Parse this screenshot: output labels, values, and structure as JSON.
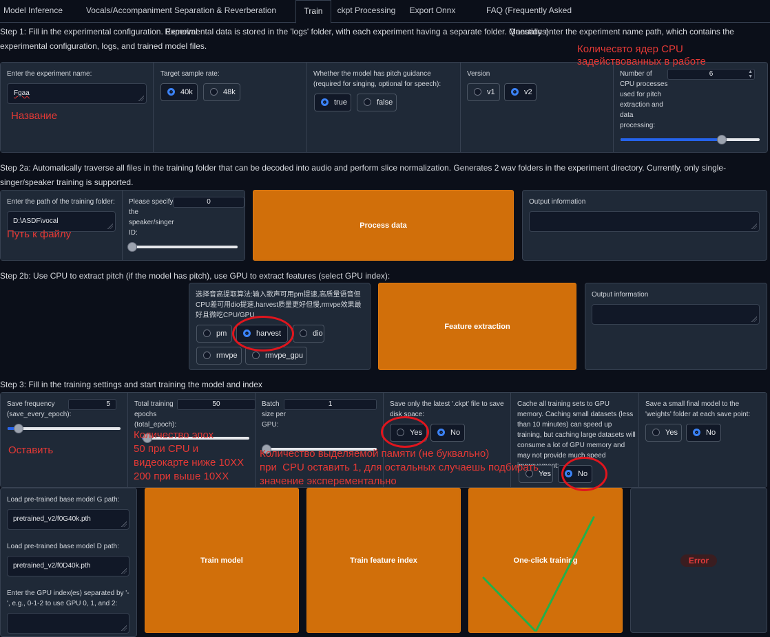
{
  "tabs": [
    "Model Inference",
    "Vocals/Accompaniment Separation & Reverberation Removal",
    "Train",
    "ckpt Processing",
    "Export Onnx",
    "FAQ (Frequently Asked Questions)"
  ],
  "step1": {
    "text": "Step 1: Fill in the experimental configuration. Experimental data is stored in the 'logs' folder, with each experiment having a separate folder. Manually enter the experiment name path, which contains the experimental configuration, logs, and trained model files.",
    "exp_name_label": "Enter the experiment name:",
    "exp_name_value": "Fgaa",
    "sr_label": "Target sample rate:",
    "sr_options": [
      "40k",
      "48k"
    ],
    "pitch_label": "Whether the model has pitch guidance (required for singing, optional for speech):",
    "pitch_options": [
      "true",
      "false"
    ],
    "version_label": "Version",
    "version_options": [
      "v1",
      "v2"
    ],
    "cpu_label": "Number of CPU processes used for pitch extraction and data processing:",
    "cpu_value": "6",
    "cpu_slider_fraction": 0.73
  },
  "step2a": {
    "text": "Step 2a: Automatically traverse all files in the training folder that can be decoded into audio and perform slice normalization. Generates 2 wav folders in the experiment directory. Currently, only single-singer/speaker training is supported.",
    "folder_label": "Enter the path of the training folder:",
    "folder_value": "D:\\ASDF\\vocal",
    "speaker_label": "Please specify the speaker/singer ID:",
    "speaker_value": "0",
    "speaker_slider_fraction": 0.0,
    "process_button": "Process data",
    "output_label": "Output information"
  },
  "step2b": {
    "text": "Step 2b: Use CPU to extract pitch (if the model has pitch), use GPU to extract features (select GPU index):",
    "method_label": "选择音高提取算法:输入歌声可用pm提速,高质量语音但CPU差可用dio提速,harvest质量更好但慢,rmvpe效果最好且微吃CPU/GPU",
    "method_options": [
      "pm",
      "harvest",
      "dio",
      "rmvpe",
      "rmvpe_gpu"
    ],
    "feature_button": "Feature extraction",
    "output_label": "Output information"
  },
  "step3": {
    "text": "Step 3: Fill in the training settings and start training the model and index",
    "save_freq_label": "Save frequency (save_every_epoch):",
    "save_freq_value": "5",
    "save_freq_fraction": 0.1,
    "epochs_label": "Total training epochs (total_epoch):",
    "epochs_value": "50",
    "epochs_fraction": 0.05,
    "batch_label": "Batch size per GPU:",
    "batch_value": "1",
    "batch_fraction": 0.0,
    "latest_label": "Save only the latest '.ckpt' file to save disk space:",
    "cache_label": "Cache all training sets to GPU memory. Caching small datasets (less than 10 minutes) can speed up training, but caching large datasets will consume a lot of GPU memory and may not provide much speed improvement:",
    "small_label": "Save a small final model to the 'weights' folder at each save point:",
    "yes": "Yes",
    "no": "No",
    "g_label": "Load pre-trained base model G path:",
    "g_value": "pretrained_v2/f0G40k.pth",
    "d_label": "Load pre-trained base model D path:",
    "d_value": "pretrained_v2/f0D40k.pth",
    "gpu_label": "Enter the GPU index(es) separated by '-', e.g., 0-1-2 to use GPU 0, 1, and 2:",
    "train_model": "Train model",
    "train_index": "Train feature index",
    "one_click": "One-click training",
    "error": "Error"
  },
  "annotations": {
    "cpu_cores": "Количесвто ядер CPU задействованных в работе",
    "name": "Название",
    "path": "Путь к файлу",
    "leave": "Оставить",
    "epochs": "Количество эпох\n50 при CPU и\nвидеокарте ниже 10XX\n200 при выше 10XX",
    "memory": "Количество выделяемой памяти (не буквально)\nпри  CPU оставить 1, для остальных случаешь подбирать\nзначение эксперементально"
  },
  "colors": {
    "accent_orange": "#d16f0a",
    "radio_blue": "#3b82f6",
    "annotation_red": "#e53935",
    "check_green": "#22b04b"
  }
}
